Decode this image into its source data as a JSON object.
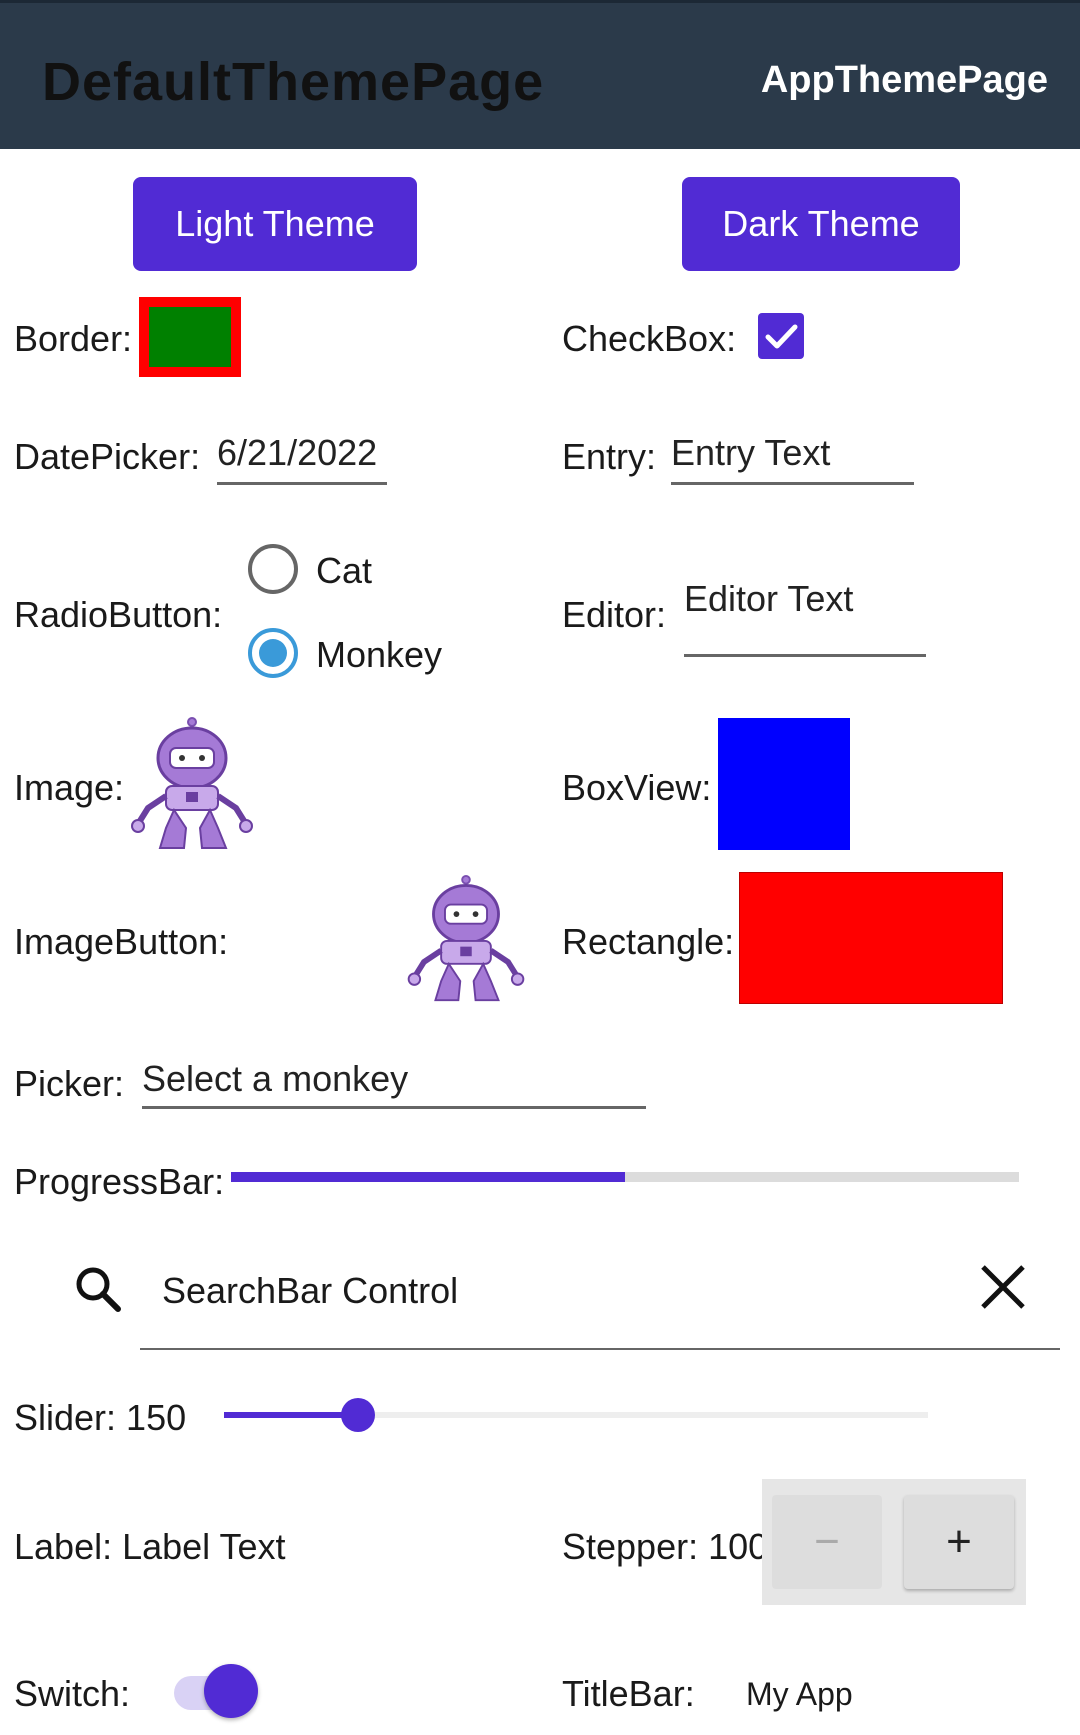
{
  "header": {
    "title": "DefaultThemePage",
    "right_action": "AppThemePage"
  },
  "buttons": {
    "light_theme": "Light Theme",
    "dark_theme": "Dark Theme"
  },
  "labels": {
    "border": "Border:",
    "checkbox": "CheckBox:",
    "datepicker": "DatePicker:",
    "entry": "Entry:",
    "radiobutton": "RadioButton:",
    "editor": "Editor:",
    "image": "Image:",
    "boxview": "BoxView:",
    "imagebutton": "ImageButton:",
    "rectangle": "Rectangle:",
    "picker": "Picker:",
    "progressbar": "ProgressBar:",
    "slider": "Slider: 150",
    "label": "Label: Label Text",
    "stepper": "Stepper: 100",
    "switch": "Switch:",
    "titlebar": "TitleBar:"
  },
  "values": {
    "date": "6/21/2022",
    "entry_text": "Entry Text",
    "editor_text": "Editor Text",
    "picker_text": "Select a monkey",
    "search_text": "SearchBar Control",
    "titlebar_text": "My App",
    "checkbox_checked": true,
    "switch_on": true,
    "progress": 0.5,
    "slider_fraction": 0.19
  },
  "radio": {
    "options": [
      "Cat",
      "Monkey"
    ],
    "selected": "Monkey"
  },
  "stepper": {
    "minus": "−",
    "plus": "+"
  },
  "icons": {
    "search": "search-icon",
    "clear": "close-icon",
    "check": "check-icon",
    "bot": "dotnet-bot-image"
  },
  "colors": {
    "accent": "#512bd4",
    "header_bg": "#2b3a4a",
    "border_fill": "#008000",
    "border_stroke": "#ff0000",
    "boxview": "#0000ff",
    "rectangle": "#ff0000",
    "radio_selected": "#3a9ad9"
  }
}
